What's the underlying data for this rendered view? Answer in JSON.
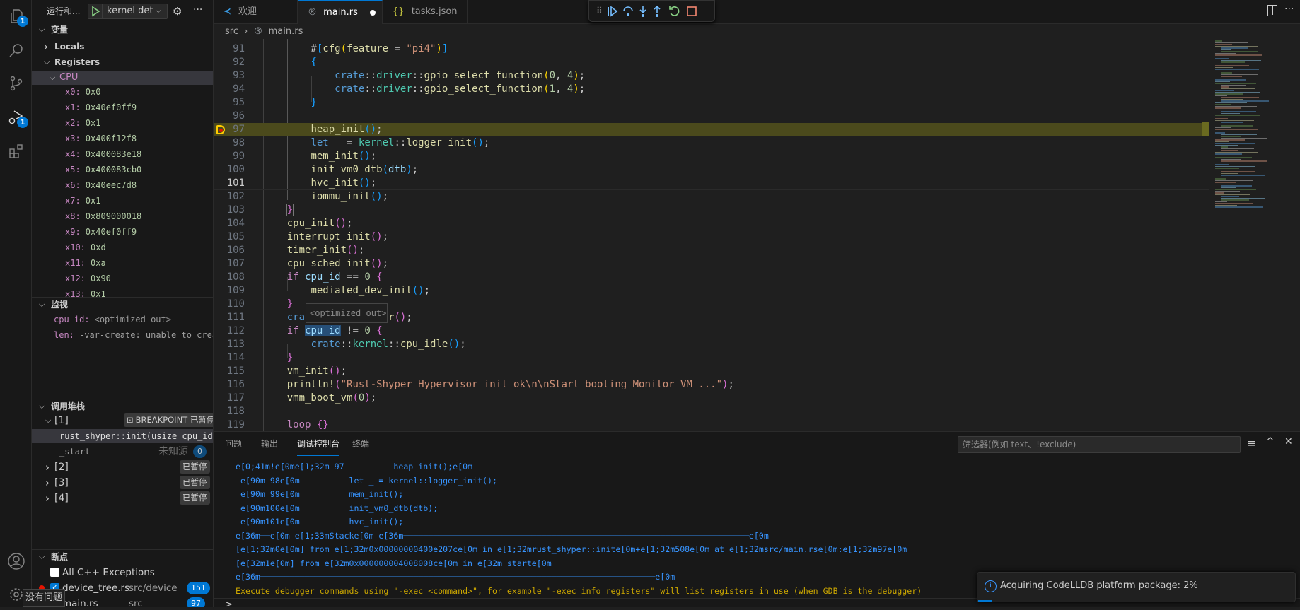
{
  "activity_bar": {
    "explorer_badge": "1",
    "debug_badge": "1"
  },
  "sidebar": {
    "title": "运行和...",
    "run_config": "kernel det",
    "variables": {
      "header": "变量",
      "locals": "Locals",
      "registers": "Registers",
      "cpu": "CPU",
      "registers_list": [
        {
          "name": "x0:",
          "value": "0x0"
        },
        {
          "name": "x1:",
          "value": "0x40ef0ff9"
        },
        {
          "name": "x2:",
          "value": "0x1"
        },
        {
          "name": "x3:",
          "value": "0x400f12f8"
        },
        {
          "name": "x4:",
          "value": "0x400083e18"
        },
        {
          "name": "x5:",
          "value": "0x400083cb0"
        },
        {
          "name": "x6:",
          "value": "0x40eec7d8"
        },
        {
          "name": "x7:",
          "value": "0x1"
        },
        {
          "name": "x8:",
          "value": "0x809000018"
        },
        {
          "name": "x9:",
          "value": "0x40ef0ff9"
        },
        {
          "name": "x10:",
          "value": "0xd"
        },
        {
          "name": "x11:",
          "value": "0xa"
        },
        {
          "name": "x12:",
          "value": "0x90"
        },
        {
          "name": "x13:",
          "value": "0x1"
        }
      ]
    },
    "watch": {
      "header": "监视",
      "items": [
        {
          "name": "cpu_id:",
          "value": "<optimized out>"
        },
        {
          "name": "len:",
          "value": "-var-create: unable to creat…"
        }
      ]
    },
    "call_stack": {
      "header": "调用堆栈",
      "threads": [
        {
          "label": "[1]",
          "status": "BREAKPOINT 已暂停",
          "frames": [
            {
              "name": "rust_shyper::init(usize cpu_id, *r"
            },
            {
              "name": "_start",
              "source": "未知源",
              "line": "0"
            }
          ]
        },
        {
          "label": "[2]",
          "status": "已暂停"
        },
        {
          "label": "[3]",
          "status": "已暂停"
        },
        {
          "label": "[4]",
          "status": "已暂停"
        }
      ]
    },
    "breakpoints": {
      "header": "断点",
      "items": [
        {
          "label": "All C++ Exceptions",
          "checked": false
        },
        {
          "label": "device_tree.rs",
          "path": "src/device",
          "line": "151",
          "checked": true
        },
        {
          "label": "main.rs",
          "path": "src",
          "line": "97",
          "checked": true
        }
      ]
    }
  },
  "tabs": [
    {
      "label": "欢迎"
    },
    {
      "label": "main.rs",
      "modified": true
    },
    {
      "label": "tasks.json"
    }
  ],
  "breadcrumb": {
    "folder": "src",
    "file": "main.rs"
  },
  "editor": {
    "current_line": "97",
    "cursor_line": "101",
    "lines": [
      {
        "n": "91",
        "t": [
          [
            "        #",
            "p"
          ],
          [
            "[",
            "b3"
          ],
          [
            "cfg",
            "f"
          ],
          [
            "(",
            "b1"
          ],
          [
            "feature",
            "f"
          ],
          [
            " = ",
            "p"
          ],
          [
            "\"pi4\"",
            "s"
          ],
          [
            ")",
            "b1"
          ],
          [
            "]",
            "b3"
          ]
        ]
      },
      {
        "n": "92",
        "t": [
          [
            "        ",
            "p"
          ],
          [
            "{",
            "b3"
          ]
        ]
      },
      {
        "n": "93",
        "t": [
          [
            "            ",
            "p"
          ],
          [
            "crate",
            "k"
          ],
          [
            "::",
            "p"
          ],
          [
            "driver",
            "n"
          ],
          [
            "::",
            "p"
          ],
          [
            "gpio_select_function",
            "f"
          ],
          [
            "(",
            "b1"
          ],
          [
            "0",
            "d"
          ],
          [
            ", ",
            "p"
          ],
          [
            "4",
            "d"
          ],
          [
            ")",
            "b1"
          ],
          [
            ";",
            "p"
          ]
        ]
      },
      {
        "n": "94",
        "t": [
          [
            "            ",
            "p"
          ],
          [
            "crate",
            "k"
          ],
          [
            "::",
            "p"
          ],
          [
            "driver",
            "n"
          ],
          [
            "::",
            "p"
          ],
          [
            "gpio_select_function",
            "f"
          ],
          [
            "(",
            "b1"
          ],
          [
            "1",
            "d"
          ],
          [
            ", ",
            "p"
          ],
          [
            "4",
            "d"
          ],
          [
            ")",
            "b1"
          ],
          [
            ";",
            "p"
          ]
        ]
      },
      {
        "n": "95",
        "t": [
          [
            "        ",
            "p"
          ],
          [
            "}",
            "b3"
          ]
        ]
      },
      {
        "n": "96",
        "t": []
      },
      {
        "n": "97",
        "t": [
          [
            "        ",
            "p"
          ],
          [
            "heap_init",
            "f"
          ],
          [
            "()",
            "b3"
          ],
          [
            ";",
            "p"
          ]
        ]
      },
      {
        "n": "98",
        "t": [
          [
            "        ",
            "p"
          ],
          [
            "let",
            "k"
          ],
          [
            " _ = ",
            "p"
          ],
          [
            "kernel",
            "n"
          ],
          [
            "::",
            "p"
          ],
          [
            "logger_init",
            "f"
          ],
          [
            "()",
            "b3"
          ],
          [
            ";",
            "p"
          ]
        ]
      },
      {
        "n": "99",
        "t": [
          [
            "        ",
            "p"
          ],
          [
            "mem_init",
            "f"
          ],
          [
            "()",
            "b3"
          ],
          [
            ";",
            "p"
          ]
        ]
      },
      {
        "n": "100",
        "t": [
          [
            "        ",
            "p"
          ],
          [
            "init_vm0_dtb",
            "f"
          ],
          [
            "(",
            "b3"
          ],
          [
            "dtb",
            "v"
          ],
          [
            ")",
            "b3"
          ],
          [
            ";",
            "p"
          ]
        ]
      },
      {
        "n": "101",
        "t": [
          [
            "        ",
            "p"
          ],
          [
            "hvc_init",
            "f"
          ],
          [
            "()",
            "b3"
          ],
          [
            ";",
            "p"
          ]
        ]
      },
      {
        "n": "102",
        "t": [
          [
            "        ",
            "p"
          ],
          [
            "iommu_init",
            "f"
          ],
          [
            "()",
            "b3"
          ],
          [
            ";",
            "p"
          ]
        ]
      },
      {
        "n": "103",
        "t": [
          [
            "    ",
            "p"
          ],
          [
            "}",
            "b2"
          ]
        ]
      },
      {
        "n": "104",
        "t": [
          [
            "    ",
            "p"
          ],
          [
            "cpu_init",
            "f"
          ],
          [
            "()",
            "b2"
          ],
          [
            ";",
            "p"
          ]
        ]
      },
      {
        "n": "105",
        "t": [
          [
            "    ",
            "p"
          ],
          [
            "interrupt_init",
            "f"
          ],
          [
            "()",
            "b2"
          ],
          [
            ";",
            "p"
          ]
        ]
      },
      {
        "n": "106",
        "t": [
          [
            "    ",
            "p"
          ],
          [
            "timer_init",
            "f"
          ],
          [
            "()",
            "b2"
          ],
          [
            ";",
            "p"
          ]
        ]
      },
      {
        "n": "107",
        "t": [
          [
            "    ",
            "p"
          ],
          [
            "cpu_sched_init",
            "f"
          ],
          [
            "()",
            "b2"
          ],
          [
            ";",
            "p"
          ]
        ]
      },
      {
        "n": "108",
        "t": [
          [
            "    ",
            "p"
          ],
          [
            "if",
            "c"
          ],
          [
            " ",
            "p"
          ],
          [
            "cpu_id",
            "v"
          ],
          [
            " == ",
            "p"
          ],
          [
            "0",
            "d"
          ],
          [
            " ",
            "p"
          ],
          [
            "{",
            "b2"
          ]
        ]
      },
      {
        "n": "109",
        "t": [
          [
            "        ",
            "p"
          ],
          [
            "mediated_dev_init",
            "f"
          ],
          [
            "()",
            "b3"
          ],
          [
            ";",
            "p"
          ]
        ]
      },
      {
        "n": "110",
        "t": [
          [
            "    ",
            "p"
          ],
          [
            "}",
            "b2"
          ]
        ]
      },
      {
        "n": "111",
        "t": [
          [
            "    ",
            "p"
          ],
          [
            "cra",
            "k"
          ],
          [
            "             ",
            "p"
          ],
          [
            "er",
            "f"
          ],
          [
            "()",
            "b2"
          ],
          [
            ";",
            "p"
          ]
        ]
      },
      {
        "n": "112",
        "t": [
          [
            "    ",
            "p"
          ],
          [
            "if",
            "c"
          ],
          [
            " ",
            "p"
          ],
          [
            "cpu_id",
            "vh"
          ],
          [
            " != ",
            "p"
          ],
          [
            "0",
            "d"
          ],
          [
            " ",
            "p"
          ],
          [
            "{",
            "b2"
          ]
        ]
      },
      {
        "n": "113",
        "t": [
          [
            "        ",
            "p"
          ],
          [
            "crate",
            "k"
          ],
          [
            "::",
            "p"
          ],
          [
            "kernel",
            "n"
          ],
          [
            "::",
            "p"
          ],
          [
            "cpu_idle",
            "f"
          ],
          [
            "()",
            "b3"
          ],
          [
            ";",
            "p"
          ]
        ]
      },
      {
        "n": "114",
        "t": [
          [
            "    ",
            "p"
          ],
          [
            "}",
            "b2"
          ]
        ]
      },
      {
        "n": "115",
        "t": [
          [
            "    ",
            "p"
          ],
          [
            "vm_init",
            "f"
          ],
          [
            "()",
            "b2"
          ],
          [
            ";",
            "p"
          ]
        ]
      },
      {
        "n": "116",
        "t": [
          [
            "    ",
            "p"
          ],
          [
            "println!",
            "f"
          ],
          [
            "(",
            "b2"
          ],
          [
            "\"Rust-Shyper Hypervisor init ok\\n\\nStart booting Monitor VM ...\"",
            "s"
          ],
          [
            ")",
            "b2"
          ],
          [
            ";",
            "p"
          ]
        ]
      },
      {
        "n": "117",
        "t": [
          [
            "    ",
            "p"
          ],
          [
            "vmm_boot_vm",
            "f"
          ],
          [
            "(",
            "b2"
          ],
          [
            "0",
            "d"
          ],
          [
            ")",
            "b2"
          ],
          [
            ";",
            "p"
          ]
        ]
      },
      {
        "n": "118",
        "t": []
      },
      {
        "n": "119",
        "t": [
          [
            "    ",
            "p"
          ],
          [
            "loop",
            "c"
          ],
          [
            " ",
            "p"
          ],
          [
            "{}",
            "b2"
          ]
        ]
      }
    ]
  },
  "hover": "<optimized out>",
  "panel": {
    "tabs": [
      "问题",
      "输出",
      "调试控制台",
      "终端"
    ],
    "active_tab": "调试控制台",
    "filter_placeholder": "筛选器(例如 text、!exclude)",
    "console_lines": [
      {
        "text": "e[0;41m!e[0me[1;32m 97          heap_init();e[0m",
        "kind": "info"
      },
      {
        "text": " e[90m 98e[0m          let _ = kernel::logger_init();",
        "kind": "info"
      },
      {
        "text": " e[90m 99e[0m          mem_init();",
        "kind": "info"
      },
      {
        "text": " e[90m100e[0m          init_vm0_dtb(dtb);",
        "kind": "info"
      },
      {
        "text": " e[90m101e[0m          hvc_init();",
        "kind": "info"
      },
      {
        "text": "e[36m──e[0m e[1;33mStacke[0m e[36m──────────────────────────────────────────────────────────────────────e[0m",
        "kind": "info"
      },
      {
        "text": "[e[1;32m0e[0m] from e[1;32m0x00000000400e207ce[0m in e[1;32mrust_shyper::inite[0m+e[1;32m508e[0m at e[1;32msrc/main.rse[0m:e[1;32m97e[0m",
        "kind": "info"
      },
      {
        "text": "[e[32m1e[0m] from e[32m0x000000004008008ce[0m in e[32m_starte[0m",
        "kind": "info"
      },
      {
        "text": "e[36m────────────────────────────────────────────────────────────────────────────────e[0m",
        "kind": "info"
      },
      {
        "text": "Execute debugger commands using \"-exec <command>\", for example \"-exec info registers\" will list registers in use (when GDB is the debugger)",
        "kind": "warning"
      }
    ],
    "prompt": ">"
  },
  "notification": {
    "text": "Acquiring CodeLLDB platform package: 2%",
    "progress": 0.02
  },
  "tooltip": "没有问题",
  "colors": {
    "accent": "#0078d4",
    "current_line": "#4b4a1c",
    "console_info": "#3794ff",
    "console_warning": "#cca700",
    "breakpoint": "#e51400"
  }
}
